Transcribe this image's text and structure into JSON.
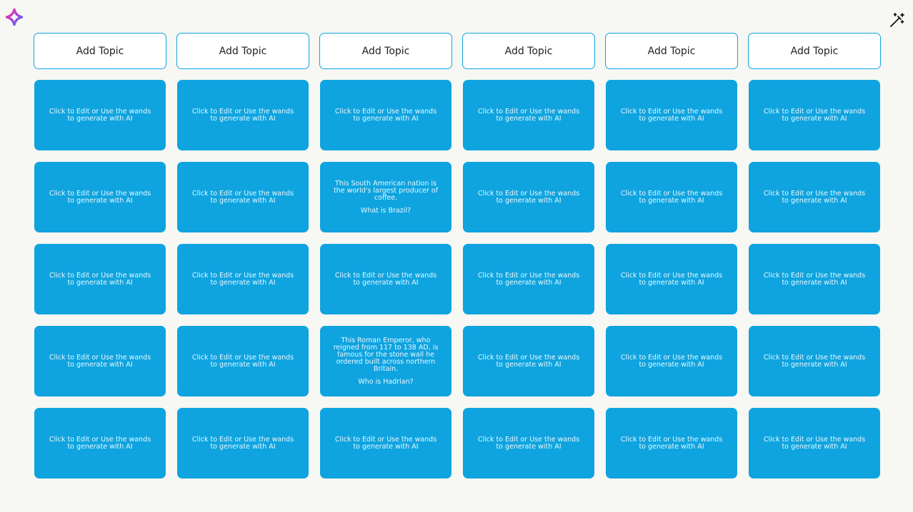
{
  "colors": {
    "background": "#f7f7f3",
    "card": "#0fa4df",
    "topic_border": "#0ea5e0"
  },
  "icons": {
    "logo": "sparkle-logo-icon",
    "wand": "magic-wand-icon"
  },
  "topics": [
    {
      "label": "Add Topic"
    },
    {
      "label": "Add Topic"
    },
    {
      "label": "Add Topic"
    },
    {
      "label": "Add Topic"
    },
    {
      "label": "Add Topic"
    },
    {
      "label": "Add Topic"
    }
  ],
  "cards": [
    [
      {
        "text": "Click to Edit or Use the wands to generate with AI"
      },
      {
        "text": "Click to Edit or Use the wands to generate with AI"
      },
      {
        "text": "Click to Edit or Use the wands to generate with AI"
      },
      {
        "text": "Click to Edit or Use the wands to generate with AI"
      },
      {
        "text": "Click to Edit or Use the wands to generate with AI"
      },
      {
        "text": "Click to Edit or Use the wands to generate with AI"
      }
    ],
    [
      {
        "text": "Click to Edit or Use the wands to generate with AI"
      },
      {
        "text": "Click to Edit or Use the wands to generate with AI"
      },
      {
        "question": "This South American nation is the world's largest producer of coffee.",
        "answer": "What is Brazil?"
      },
      {
        "text": "Click to Edit or Use the wands to generate with AI"
      },
      {
        "text": "Click to Edit or Use the wands to generate with AI"
      },
      {
        "text": "Click to Edit or Use the wands to generate with AI"
      }
    ],
    [
      {
        "text": "Click to Edit or Use the wands to generate with AI"
      },
      {
        "text": "Click to Edit or Use the wands to generate with AI"
      },
      {
        "text": "Click to Edit or Use the wands to generate with AI"
      },
      {
        "text": "Click to Edit or Use the wands to generate with AI"
      },
      {
        "text": "Click to Edit or Use the wands to generate with AI"
      },
      {
        "text": "Click to Edit or Use the wands to generate with AI"
      }
    ],
    [
      {
        "text": "Click to Edit or Use the wands to generate with AI"
      },
      {
        "text": "Click to Edit or Use the wands to generate with AI"
      },
      {
        "question": "This Roman Emperor, who reigned from 117 to 138 AD, is famous for the stone wall he ordered built across northern Britain.",
        "answer": "Who is Hadrian?"
      },
      {
        "text": "Click to Edit or Use the wands to generate with AI"
      },
      {
        "text": "Click to Edit or Use the wands to generate with AI"
      },
      {
        "text": "Click to Edit or Use the wands to generate with AI"
      }
    ],
    [
      {
        "text": "Click to Edit or Use the wands to generate with AI"
      },
      {
        "text": "Click to Edit or Use the wands to generate with AI"
      },
      {
        "text": "Click to Edit or Use the wands to generate with AI"
      },
      {
        "text": "Click to Edit or Use the wands to generate with AI"
      },
      {
        "text": "Click to Edit or Use the wands to generate with AI"
      },
      {
        "text": "Click to Edit or Use the wands to generate with AI"
      }
    ]
  ]
}
